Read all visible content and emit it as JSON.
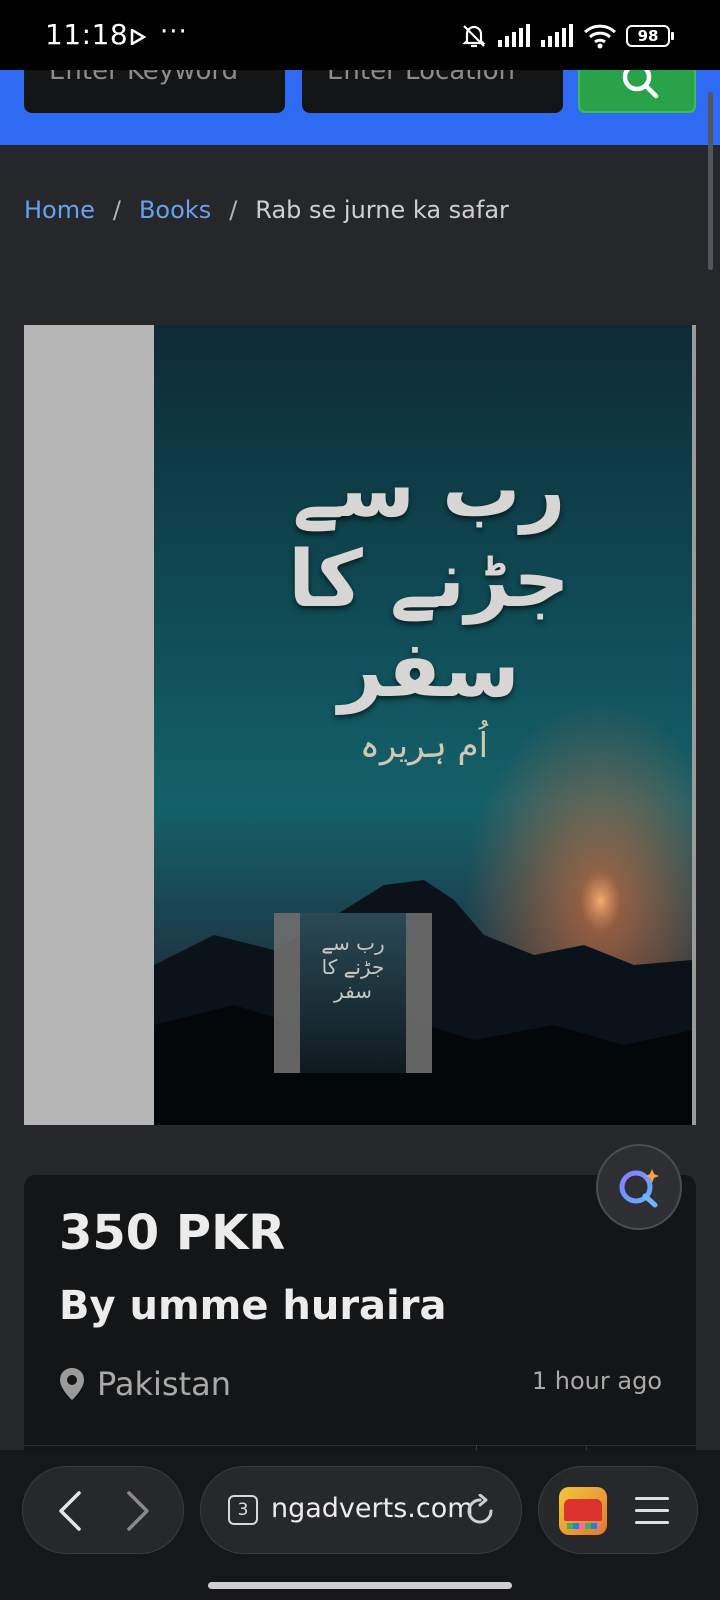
{
  "status": {
    "time": "11:18",
    "battery": "98"
  },
  "search": {
    "keyword_placeholder": "Enter Keyword",
    "location_placeholder": "Enter Location"
  },
  "breadcrumb": {
    "home": "Home",
    "category": "Books",
    "current": "Rab se jurne ka safar"
  },
  "gallery": {
    "cover_title": "رب سے جڑنے کا سفر",
    "cover_author": "اُم ہریرہ",
    "thumb_title": "رب سے جڑنے کا سفر"
  },
  "listing": {
    "price": "350 PKR",
    "author": "By umme huraira",
    "location": "Pakistan",
    "posted": "1 hour ago"
  },
  "browser": {
    "tab_count": "3",
    "url": "ngadverts.com"
  },
  "colors": {
    "header_blue": "#2f6bf2",
    "search_green": "#2aa24a",
    "link_blue": "#6aa0f0"
  }
}
